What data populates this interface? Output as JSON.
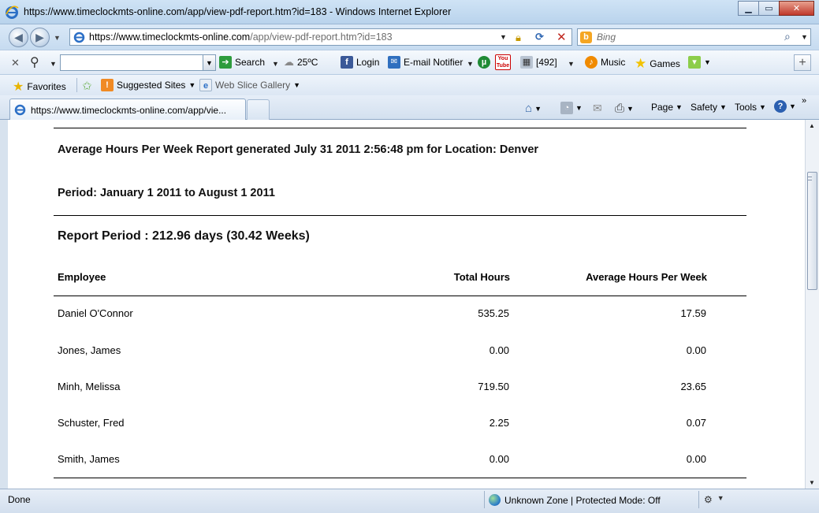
{
  "window": {
    "title": "https://www.timeclockmts-online.com/app/view-pdf-report.htm?id=183 - Windows Internet Explorer"
  },
  "address_bar": {
    "url_domain": "https://www.timeclockmts-online.com",
    "url_path": "/app/view-pdf-report.htm?id=183",
    "search_placeholder": "Bing"
  },
  "toolbar": {
    "search_value": "",
    "search_label": "Search",
    "weather": "25ºC",
    "login_label": "Login",
    "email_notifier_label": "E-mail Notifier",
    "youtube_label": "You\nTube",
    "count_label": "[492]",
    "music_label": "Music",
    "games_label": "Games"
  },
  "favorites_bar": {
    "favorites_label": "Favorites",
    "suggested_sites_label": "Suggested Sites",
    "web_slice_label": "Web Slice Gallery"
  },
  "tabs": [
    {
      "title": "https://www.timeclockmts-online.com/app/vie..."
    }
  ],
  "command_bar": {
    "page_label": "Page",
    "safety_label": "Safety",
    "tools_label": "Tools"
  },
  "report": {
    "title": "Average Hours Per Week Report generated July 31 2011 2:56:48 pm for Location: Denver",
    "period": "Period: January 1 2011 to August 1 2011",
    "report_period": "Report Period : 212.96 days (30.42 Weeks)",
    "columns": {
      "employee": "Employee",
      "total": "Total Hours",
      "average": "Average Hours Per Week"
    },
    "rows": [
      {
        "name": "Daniel O'Connor",
        "total": "535.25",
        "average": "17.59"
      },
      {
        "name": "Jones, James",
        "total": "0.00",
        "average": "0.00"
      },
      {
        "name": "Minh, Melissa",
        "total": "719.50",
        "average": "23.65"
      },
      {
        "name": "Schuster, Fred",
        "total": "2.25",
        "average": "0.07"
      },
      {
        "name": "Smith, James",
        "total": "0.00",
        "average": "0.00"
      }
    ]
  },
  "status_bar": {
    "status": "Done",
    "zone": "Unknown Zone | Protected Mode: Off"
  },
  "colors": {
    "chrome_blue": "#c6dbf0",
    "link_blue": "#2a63b0",
    "close_red": "#c0392b"
  }
}
